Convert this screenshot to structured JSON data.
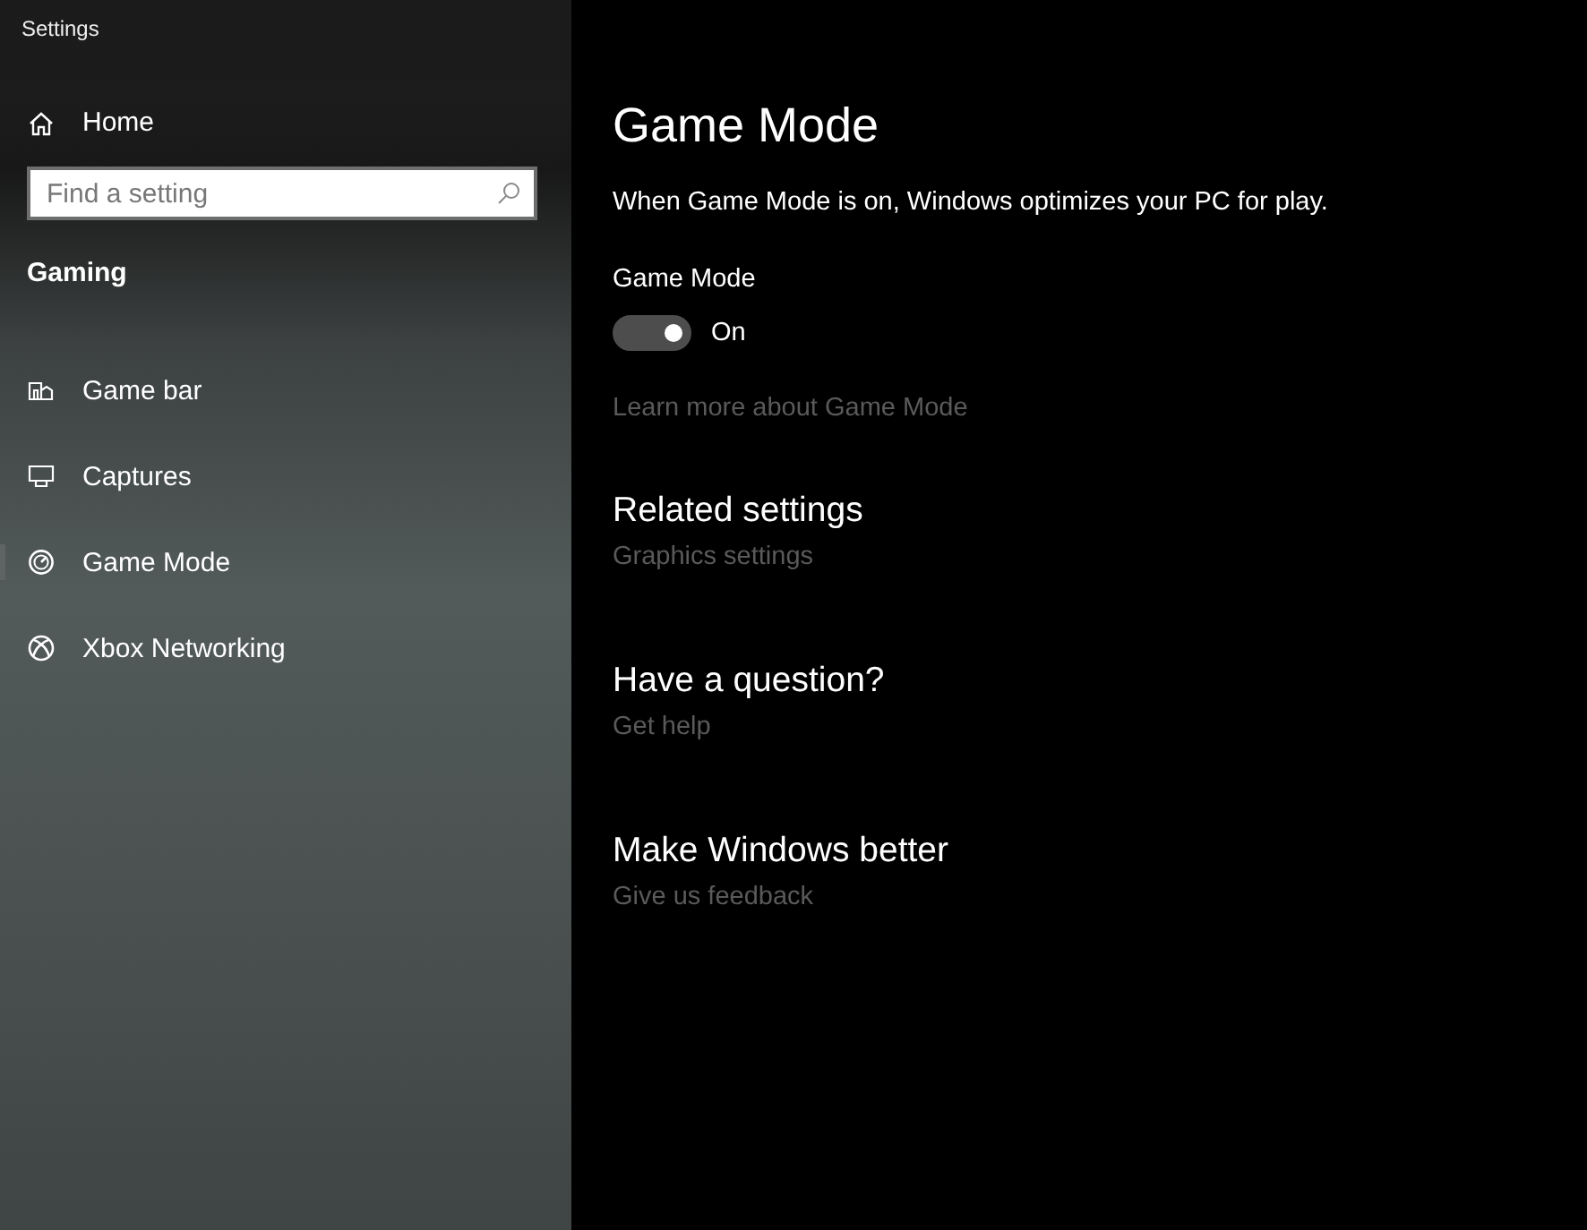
{
  "window": {
    "title": "Settings"
  },
  "sidebar": {
    "home": {
      "label": "Home"
    },
    "search": {
      "placeholder": "Find a setting"
    },
    "section": "Gaming",
    "items": [
      {
        "label": "Game bar",
        "kind": "gamebar",
        "selected": false
      },
      {
        "label": "Captures",
        "kind": "captures",
        "selected": false
      },
      {
        "label": "Game Mode",
        "kind": "gauge",
        "selected": true
      },
      {
        "label": "Xbox Networking",
        "kind": "xbox",
        "selected": false
      }
    ]
  },
  "main": {
    "title": "Game Mode",
    "description": "When Game Mode is on, Windows optimizes your PC for play.",
    "toggle": {
      "label": "Game Mode",
      "on": true,
      "state_text": "On"
    },
    "link": "Learn more about Game Mode",
    "sections": [
      {
        "heading": "Related settings",
        "link": "Graphics settings"
      },
      {
        "heading": "Have a question?",
        "link": "Get help"
      },
      {
        "heading": "Make Windows better",
        "link": "Give us feedback"
      }
    ]
  }
}
